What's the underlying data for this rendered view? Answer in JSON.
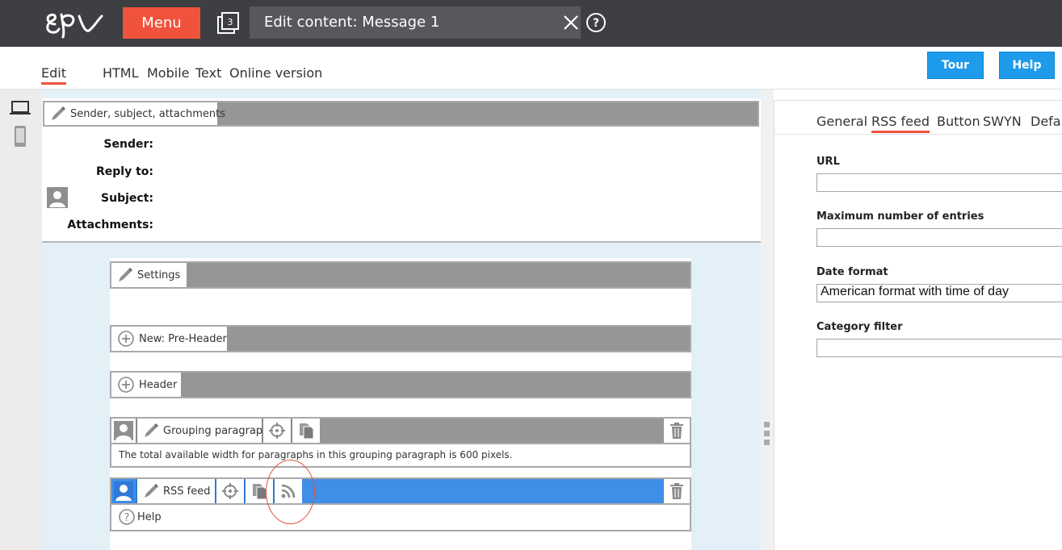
{
  "topbar": {
    "menu_label": "Menu",
    "open_tabs_count": "3",
    "title": "Edit content: Message 1",
    "colors": {
      "bar": "#3d3f42",
      "menu": "#f0533c"
    }
  },
  "view_tabs": [
    {
      "label": "Edit",
      "active": true
    },
    {
      "label": "HTML"
    },
    {
      "label": "Mobile"
    },
    {
      "label": "Text"
    },
    {
      "label": "Online version"
    }
  ],
  "buttons": {
    "tour": "Tour",
    "help": "Help"
  },
  "header_block": {
    "label": "Sender, subject, attachments",
    "fields": [
      "Sender:",
      "Reply to:",
      "Subject:",
      "Attachments:"
    ]
  },
  "blocks": {
    "settings": "Settings",
    "pre_header": "New: Pre-Header",
    "header": "Header",
    "grouping": "Grouping paragraph",
    "grouping_info": "The total available width for paragraphs in this grouping paragraph is 600 pixels.",
    "rss": "RSS feed",
    "help": "Help"
  },
  "right_tabs": [
    {
      "label": "General"
    },
    {
      "label": "RSS feed",
      "active": true
    },
    {
      "label": "Button"
    },
    {
      "label": "SWYN"
    },
    {
      "label": "Defau"
    }
  ],
  "form": {
    "url_label": "URL",
    "url_value": "",
    "max_entries_label": "Maximum number of entries",
    "max_entries_value": "",
    "date_format_label": "Date format",
    "date_format_value": "American format with time of day",
    "category_filter_label": "Category filter",
    "category_filter_value": ""
  },
  "icons": [
    "epi-logo",
    "tabs-icon",
    "close-icon",
    "help-icon",
    "laptop-icon",
    "phone-icon",
    "pen-icon",
    "plus-circle-icon",
    "person-icon",
    "target-icon",
    "copy-icon",
    "trash-icon",
    "rss-icon",
    "question-icon"
  ]
}
